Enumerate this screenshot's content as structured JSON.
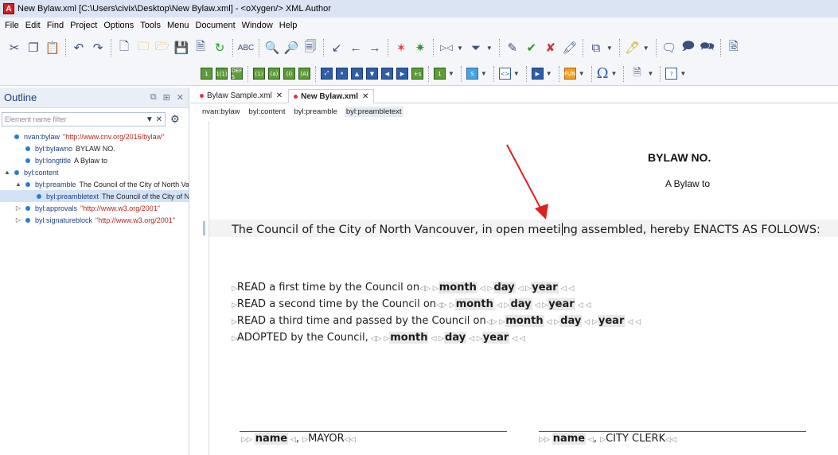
{
  "window": {
    "title": "New Bylaw.xml [C:\\Users\\civix\\Desktop\\New Bylaw.xml] - <oXygen/> XML Author",
    "logo": "A"
  },
  "menu": [
    "File",
    "Edit",
    "Find",
    "Project",
    "Options",
    "Tools",
    "Menu",
    "Document",
    "Window",
    "Help"
  ],
  "toolbar2": {
    "g1": [
      "1",
      "1(1)",
      "DEF S"
    ],
    "g2": [
      "(1)",
      "(a)",
      "(i)",
      "(A)"
    ],
    "g4": [
      "+s"
    ],
    "g5": "1",
    "g6": "S",
    "g7": "<>",
    "g8": "FUN",
    "omega": "Ω",
    "g9": "?"
  },
  "outline": {
    "title": "Outline",
    "filter_placeholder": "Element name filter",
    "items": [
      {
        "exp": "",
        "name": "nvan:bylaw",
        "value": "\"http://www.cnv.org/2016/bylaw\"",
        "red": true,
        "indent": 0
      },
      {
        "exp": "",
        "name": "byl:bylawno",
        "value": "BYLAW NO.",
        "red": false,
        "indent": 1
      },
      {
        "exp": "",
        "name": "byl:longtitle",
        "value": "A Bylaw to",
        "red": false,
        "indent": 1
      },
      {
        "exp": "▲",
        "name": "byl:content",
        "value": "",
        "red": false,
        "indent": 0
      },
      {
        "exp": "▲",
        "name": "byl:preamble",
        "value": "The Council of the City of North Vancouver",
        "red": false,
        "indent": 1
      },
      {
        "exp": "",
        "name": "byl:preambletext",
        "value": "The Council of the City of North Vancouver",
        "red": false,
        "indent": 2
      },
      {
        "exp": "▷",
        "name": "byl:approvals",
        "value": "\"http://www.w3.org/2001\"",
        "red": true,
        "indent": 1
      },
      {
        "exp": "▷",
        "name": "byl:signatureblock",
        "value": "\"http://www.w3.org/2001\"",
        "red": true,
        "indent": 1
      }
    ]
  },
  "tabs": [
    {
      "label": "Bylaw Sample.xml",
      "active": false
    },
    {
      "label": "New Bylaw.xml",
      "active": true
    }
  ],
  "breadcrumbs": [
    "nvan:bylaw",
    "byl:content",
    "byl:preamble",
    "byl:preambletext"
  ],
  "document": {
    "bylawno": "BYLAW NO.",
    "longtitle": "A Bylaw to",
    "preamble_before": "The Council of the City of North Vancouver, in open meeti",
    "preamble_after": "ng assembled, hereby ENACTS AS FOLLOWS:",
    "approvals": [
      "READ a first time by the Council on",
      "READ a second time by the Council on",
      "READ a third time and passed by the Council on",
      "ADOPTED by the Council,"
    ],
    "field_month": "month",
    "field_day": "day",
    "field_year": "year",
    "sig_name": "name",
    "sig_mayor": "MAYOR",
    "sig_clerk": "CITY CLERK"
  },
  "colors": {
    "annotation_arrow": "#e02020",
    "tab_dot": "#e2343b",
    "outline_bullet": "#2e7bd6"
  }
}
